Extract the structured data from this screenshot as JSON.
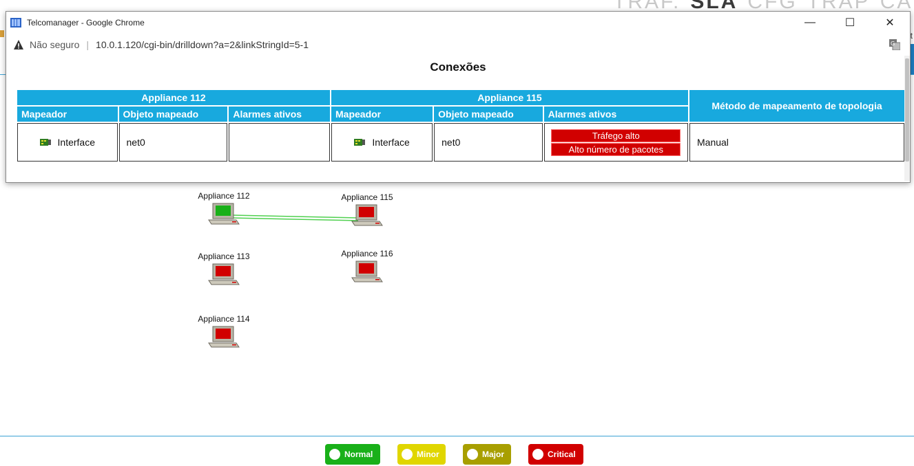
{
  "background": {
    "top_nav": [
      "TRAF.",
      "SLA",
      "CFG",
      "TRAP",
      "CALL"
    ],
    "top_nav_active": "SLA",
    "right_fragment": "t",
    "nodes": [
      {
        "label": "Appliance 112",
        "status": "normal"
      },
      {
        "label": "Appliance 115",
        "status": "critical"
      },
      {
        "label": "Appliance 113",
        "status": "critical"
      },
      {
        "label": "Appliance 116",
        "status": "critical"
      },
      {
        "label": "Appliance 114",
        "status": "critical"
      }
    ],
    "legend": [
      {
        "label": "Normal",
        "color": "#19b019"
      },
      {
        "label": "Minor",
        "color": "#e0d600"
      },
      {
        "label": "Major",
        "color": "#a89f00"
      },
      {
        "label": "Critical",
        "color": "#d10000"
      }
    ]
  },
  "popup": {
    "window_title": "Telcomanager - Google Chrome",
    "security_label": "Não seguro",
    "url": "10.0.1.120/cgi-bin/drilldown?a=2&linkStringId=5-1",
    "heading": "Conexões",
    "table": {
      "group_a": "Appliance 112",
      "group_b": "Appliance 115",
      "method_header": "Método de mapeamento de topologia",
      "sub_headers": [
        "Mapeador",
        "Objeto mapeado",
        "Alarmes ativos"
      ],
      "row": {
        "a_mapper": "Interface",
        "a_object": "net0",
        "a_alarms": [],
        "b_mapper": "Interface",
        "b_object": "net0",
        "b_alarms": [
          "Tráfego alto",
          "Alto número de pacotes"
        ],
        "method": "Manual"
      }
    }
  }
}
